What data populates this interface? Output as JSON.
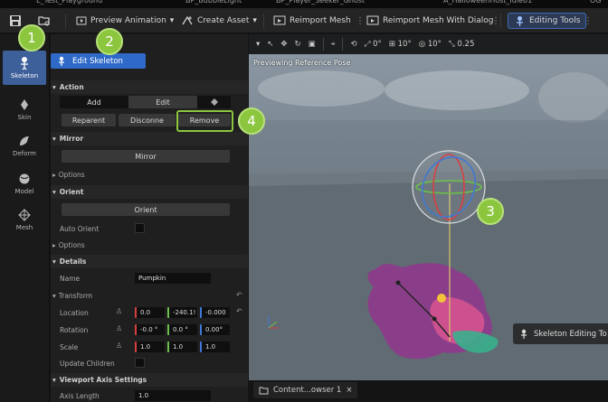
{
  "doc_tabs": [
    "L_Test_Playground",
    "BP_BubbleLight",
    "BP_Player_Seeker_Ghost",
    "A_HalloweenHost_Idle01",
    "OG"
  ],
  "toolbar": {
    "preview_animation": "Preview Animation",
    "create_asset": "Create Asset",
    "reimport_mesh": "Reimport Mesh",
    "reimport_mesh_dialog": "Reimport Mesh With Dialog",
    "editing_tools": "Editing Tools"
  },
  "modes": [
    {
      "label": "Skeleton",
      "icon": "skeleton-icon",
      "active": true
    },
    {
      "label": "Skin",
      "icon": "skin-icon",
      "active": false
    },
    {
      "label": "Deform",
      "icon": "deform-icon",
      "active": false
    },
    {
      "label": "Model",
      "icon": "model-icon",
      "active": false
    },
    {
      "label": "Mesh",
      "icon": "mesh-icon",
      "active": false
    }
  ],
  "panel": {
    "edit_skeleton": "Edit Skeleton",
    "action": {
      "title": "Action",
      "add": "Add",
      "edit": "Edit",
      "reparent": "Reparent",
      "disconnect": "Disconne",
      "remove": "Remove"
    },
    "mirror": {
      "title": "Mirror",
      "button": "Mirror",
      "options": "Options"
    },
    "orient": {
      "title": "Orient",
      "button": "Orient",
      "auto_orient": "Auto Orient",
      "options": "Options"
    },
    "details": {
      "title": "Details",
      "name_label": "Name",
      "name_value": "Pumpkin",
      "transform": "Transform",
      "location_label": "Location",
      "location": [
        "0.0",
        "-240.1!",
        "-0.000"
      ],
      "rotation_label": "Rotation",
      "rotation": [
        "-0.0 °",
        "0.0 °",
        "0.00°"
      ],
      "scale_label": "Scale",
      "scale": [
        "1.0",
        "1.0",
        "1.0"
      ],
      "update_children": "Update Children"
    },
    "viewport_axis": {
      "title": "Viewport Axis Settings",
      "axis_length_label": "Axis Length",
      "axis_length_value": "1.0"
    }
  },
  "viewport": {
    "preview_label": "Previewing Reference Pose",
    "toolbar": {
      "angle_a": "0°",
      "grid": "10°",
      "rotate_snap": "10°",
      "scale_snap": "0.25"
    },
    "badge": "Skeleton Editing To"
  },
  "bottom": {
    "content_tab": "Content...owser 1",
    "close": "×"
  },
  "callouts": [
    "1",
    "2",
    "3",
    "4"
  ],
  "colors": {
    "accent": "#2f6ac8",
    "callout": "#8cc63f",
    "axis_x": "#d64040",
    "axis_y": "#6ac04a",
    "axis_z": "#3f78d6"
  }
}
